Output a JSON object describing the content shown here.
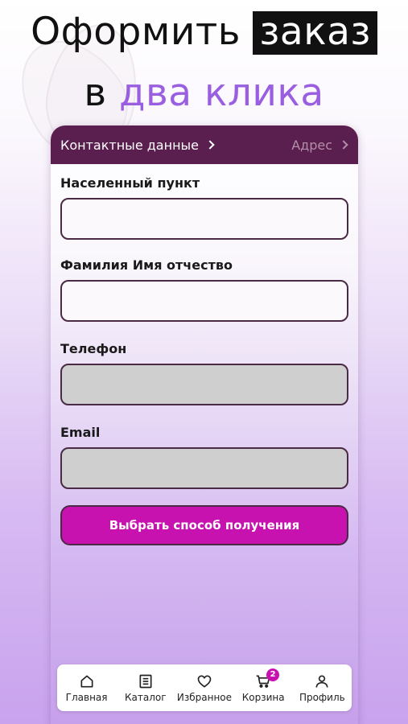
{
  "promo": {
    "line1_plain": "Оформить",
    "line1_boxed": "заказ",
    "line2_plain": "в",
    "line2_accent": "два клика"
  },
  "steps": {
    "contacts": "Контактные данные",
    "address": "Адрес"
  },
  "form": {
    "city_label": "Населенный пункт",
    "city_value": "",
    "name_label": "Фамилия Имя отчество",
    "name_value": "",
    "phone_label": "Телефон",
    "phone_value": "",
    "email_label": "Email",
    "email_value": ""
  },
  "cta_label": "Выбрать способ получения",
  "tabs": [
    {
      "label": "Главная",
      "icon": "home-icon"
    },
    {
      "label": "Каталог",
      "icon": "catalog-icon"
    },
    {
      "label": "Избранное",
      "icon": "heart-icon"
    },
    {
      "label": "Корзина",
      "icon": "cart-icon"
    },
    {
      "label": "Профиль",
      "icon": "profile-icon"
    }
  ],
  "cart_badge": "2",
  "colors": {
    "topbar": "#5a1f4e",
    "accent": "#c712b0",
    "headline_accent": "#9a5ee0"
  }
}
